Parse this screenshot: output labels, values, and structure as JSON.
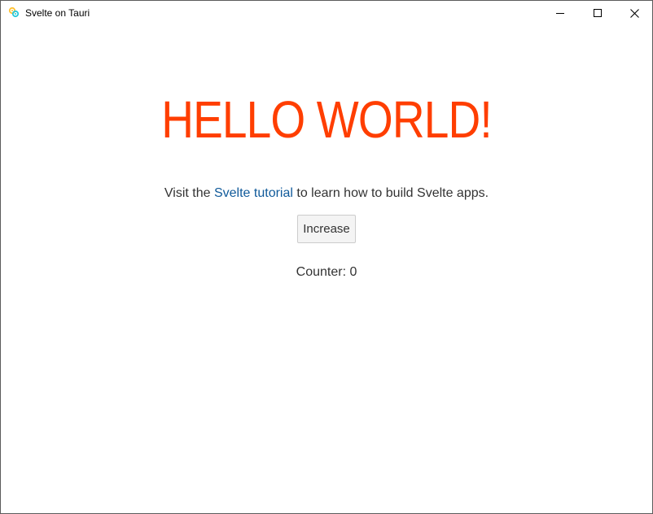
{
  "window": {
    "title": "Svelte on Tauri",
    "controls": [
      "minimize-icon",
      "maximize-icon",
      "close-icon"
    ]
  },
  "main": {
    "heading": "HELLO WORLD!",
    "visit_prefix": "Visit the ",
    "link_text": "Svelte tutorial",
    "visit_suffix": " to learn how to build Svelte apps.",
    "button_label": "Increase",
    "counter_label": "Counter: ",
    "counter_value": "0"
  },
  "colors": {
    "heading": "#ff3e00",
    "link": "#105a9a",
    "text": "#333333",
    "button_bg": "#f4f4f4",
    "button_border": "#cccccc"
  }
}
